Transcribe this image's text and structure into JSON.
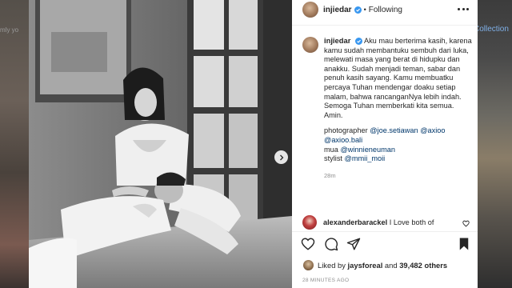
{
  "background": {
    "left_snippet": "mly yo",
    "right_snippet": "Collection"
  },
  "post": {
    "username": "injiedar",
    "follow_status": "Following",
    "caption": {
      "username": "injiedar",
      "text": "Aku mau berterima kasih, karena kamu sudah membantuku sembuh dari luka, melewati masa yang berat di hidupku dan anakku. Sudah menjadi teman, sabar dan penuh kasih sayang. Kamu membuatku percaya Tuhan mendengar doaku setiap malam, bahwa rancanganNya lebih indah. Semoga Tuhan memberkati kita semua. Amin.",
      "credits": [
        {
          "label": "photographer",
          "mentions": [
            "@joe.setiawan",
            "@axioo",
            "@axioo.bali"
          ]
        },
        {
          "label": "mua",
          "mentions": [
            "@winnieneuman"
          ]
        },
        {
          "label": "stylist",
          "mentions": [
            "@mmii_moii"
          ]
        }
      ],
      "time_ago": "28m"
    },
    "comment": {
      "username": "alexanderbarackel",
      "text": "I Love both of"
    },
    "likes": {
      "prefix": "Liked by",
      "user": "jaysforeal",
      "conjunction": "and",
      "count": "39,482 others"
    },
    "timestamp": "28 MINUTES AGO"
  },
  "icons": {
    "verified": "verified-badge-icon",
    "more": "more-options-icon",
    "like": "heart-icon",
    "comment": "comment-icon",
    "share": "paper-plane-icon",
    "save": "bookmark-icon",
    "next": "chevron-right-icon"
  },
  "colors": {
    "verified_blue": "#3897f0",
    "mention_blue": "#00376b",
    "text": "#262626",
    "muted": "#8e8e8e"
  }
}
